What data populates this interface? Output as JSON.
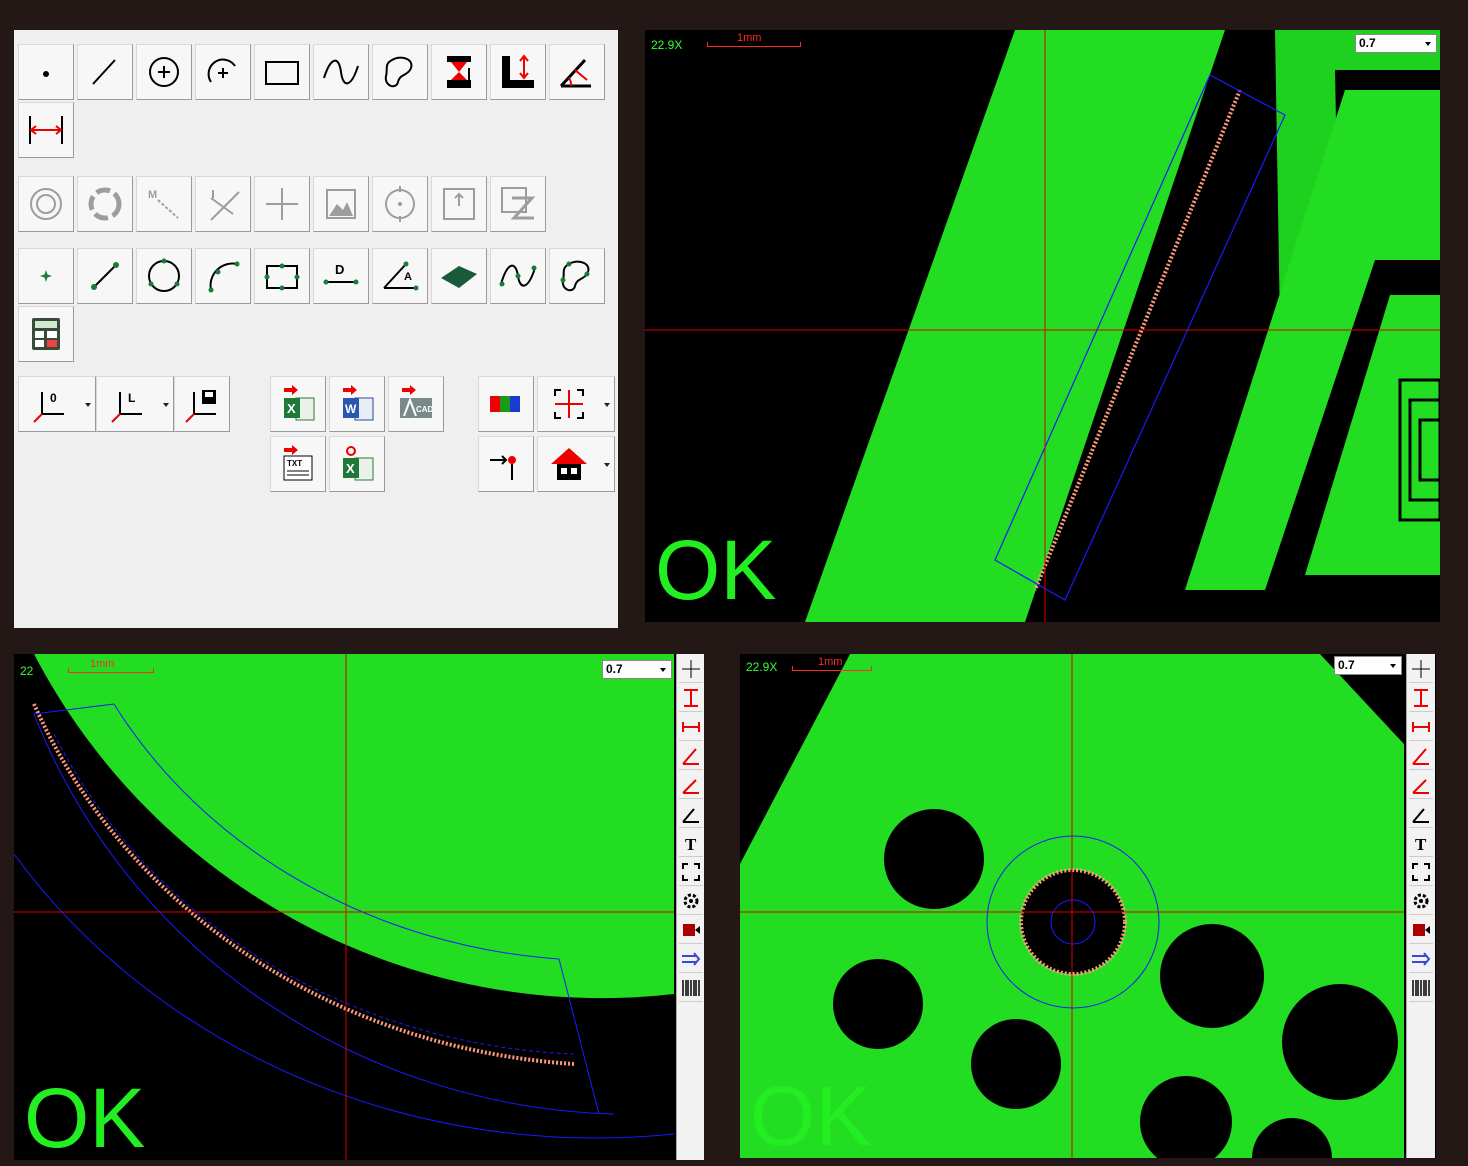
{
  "toolbar": {
    "row1": [
      "point-icon",
      "line-icon",
      "circle-icon",
      "arc-icon",
      "rectangle-icon",
      "curve-icon",
      "freeform-icon",
      "height-icon",
      "distance-icon",
      "angle-icon"
    ],
    "row1b": [
      "width-icon"
    ],
    "row2": [
      "concentric-icon",
      "ring-icon",
      "mark-icon",
      "crosshair-icon",
      "plus-icon",
      "image-icon",
      "target-icon",
      "frame-icon",
      "transform-icon"
    ],
    "row3": [
      "point-fit-icon",
      "line-fit-icon",
      "circle-fit-icon",
      "arc-fit-icon",
      "rect-fit-icon",
      "distance-d-icon",
      "angle-a-icon",
      "parallelogram-icon",
      "curve-fit-icon",
      "freeform-fit-icon"
    ],
    "row3b": [
      "calculator-icon"
    ],
    "coords": [
      {
        "icon": "coord-origin-icon",
        "label": "0"
      },
      {
        "icon": "coord-line-icon",
        "label": "L"
      },
      {
        "icon": "coord-save-icon",
        "label": ""
      }
    ],
    "exports": {
      "excel": "X",
      "word": "W",
      "cad": "CAD",
      "txt": "TXT",
      "excel_settings": "X"
    },
    "misc": [
      "color-icon",
      "crop-icon",
      "probe-icon",
      "home-icon"
    ]
  },
  "views": [
    {
      "zoom": "22.9X",
      "scale": "1mm",
      "select": "0.7",
      "status": "OK"
    },
    {
      "zoom": "22",
      "scale": "1mm",
      "select": "0.7",
      "status": "OK"
    },
    {
      "zoom": "22.9X",
      "scale": "1mm",
      "select": "0.7",
      "status": "OK"
    }
  ],
  "side_toolbar_text": "T",
  "colors": {
    "bg": "#231815",
    "board": "#22dd22",
    "edge": "#ff9a7a",
    "roi": "#1a1aff",
    "cross": "#dd0000",
    "ok": "#22ee22"
  }
}
